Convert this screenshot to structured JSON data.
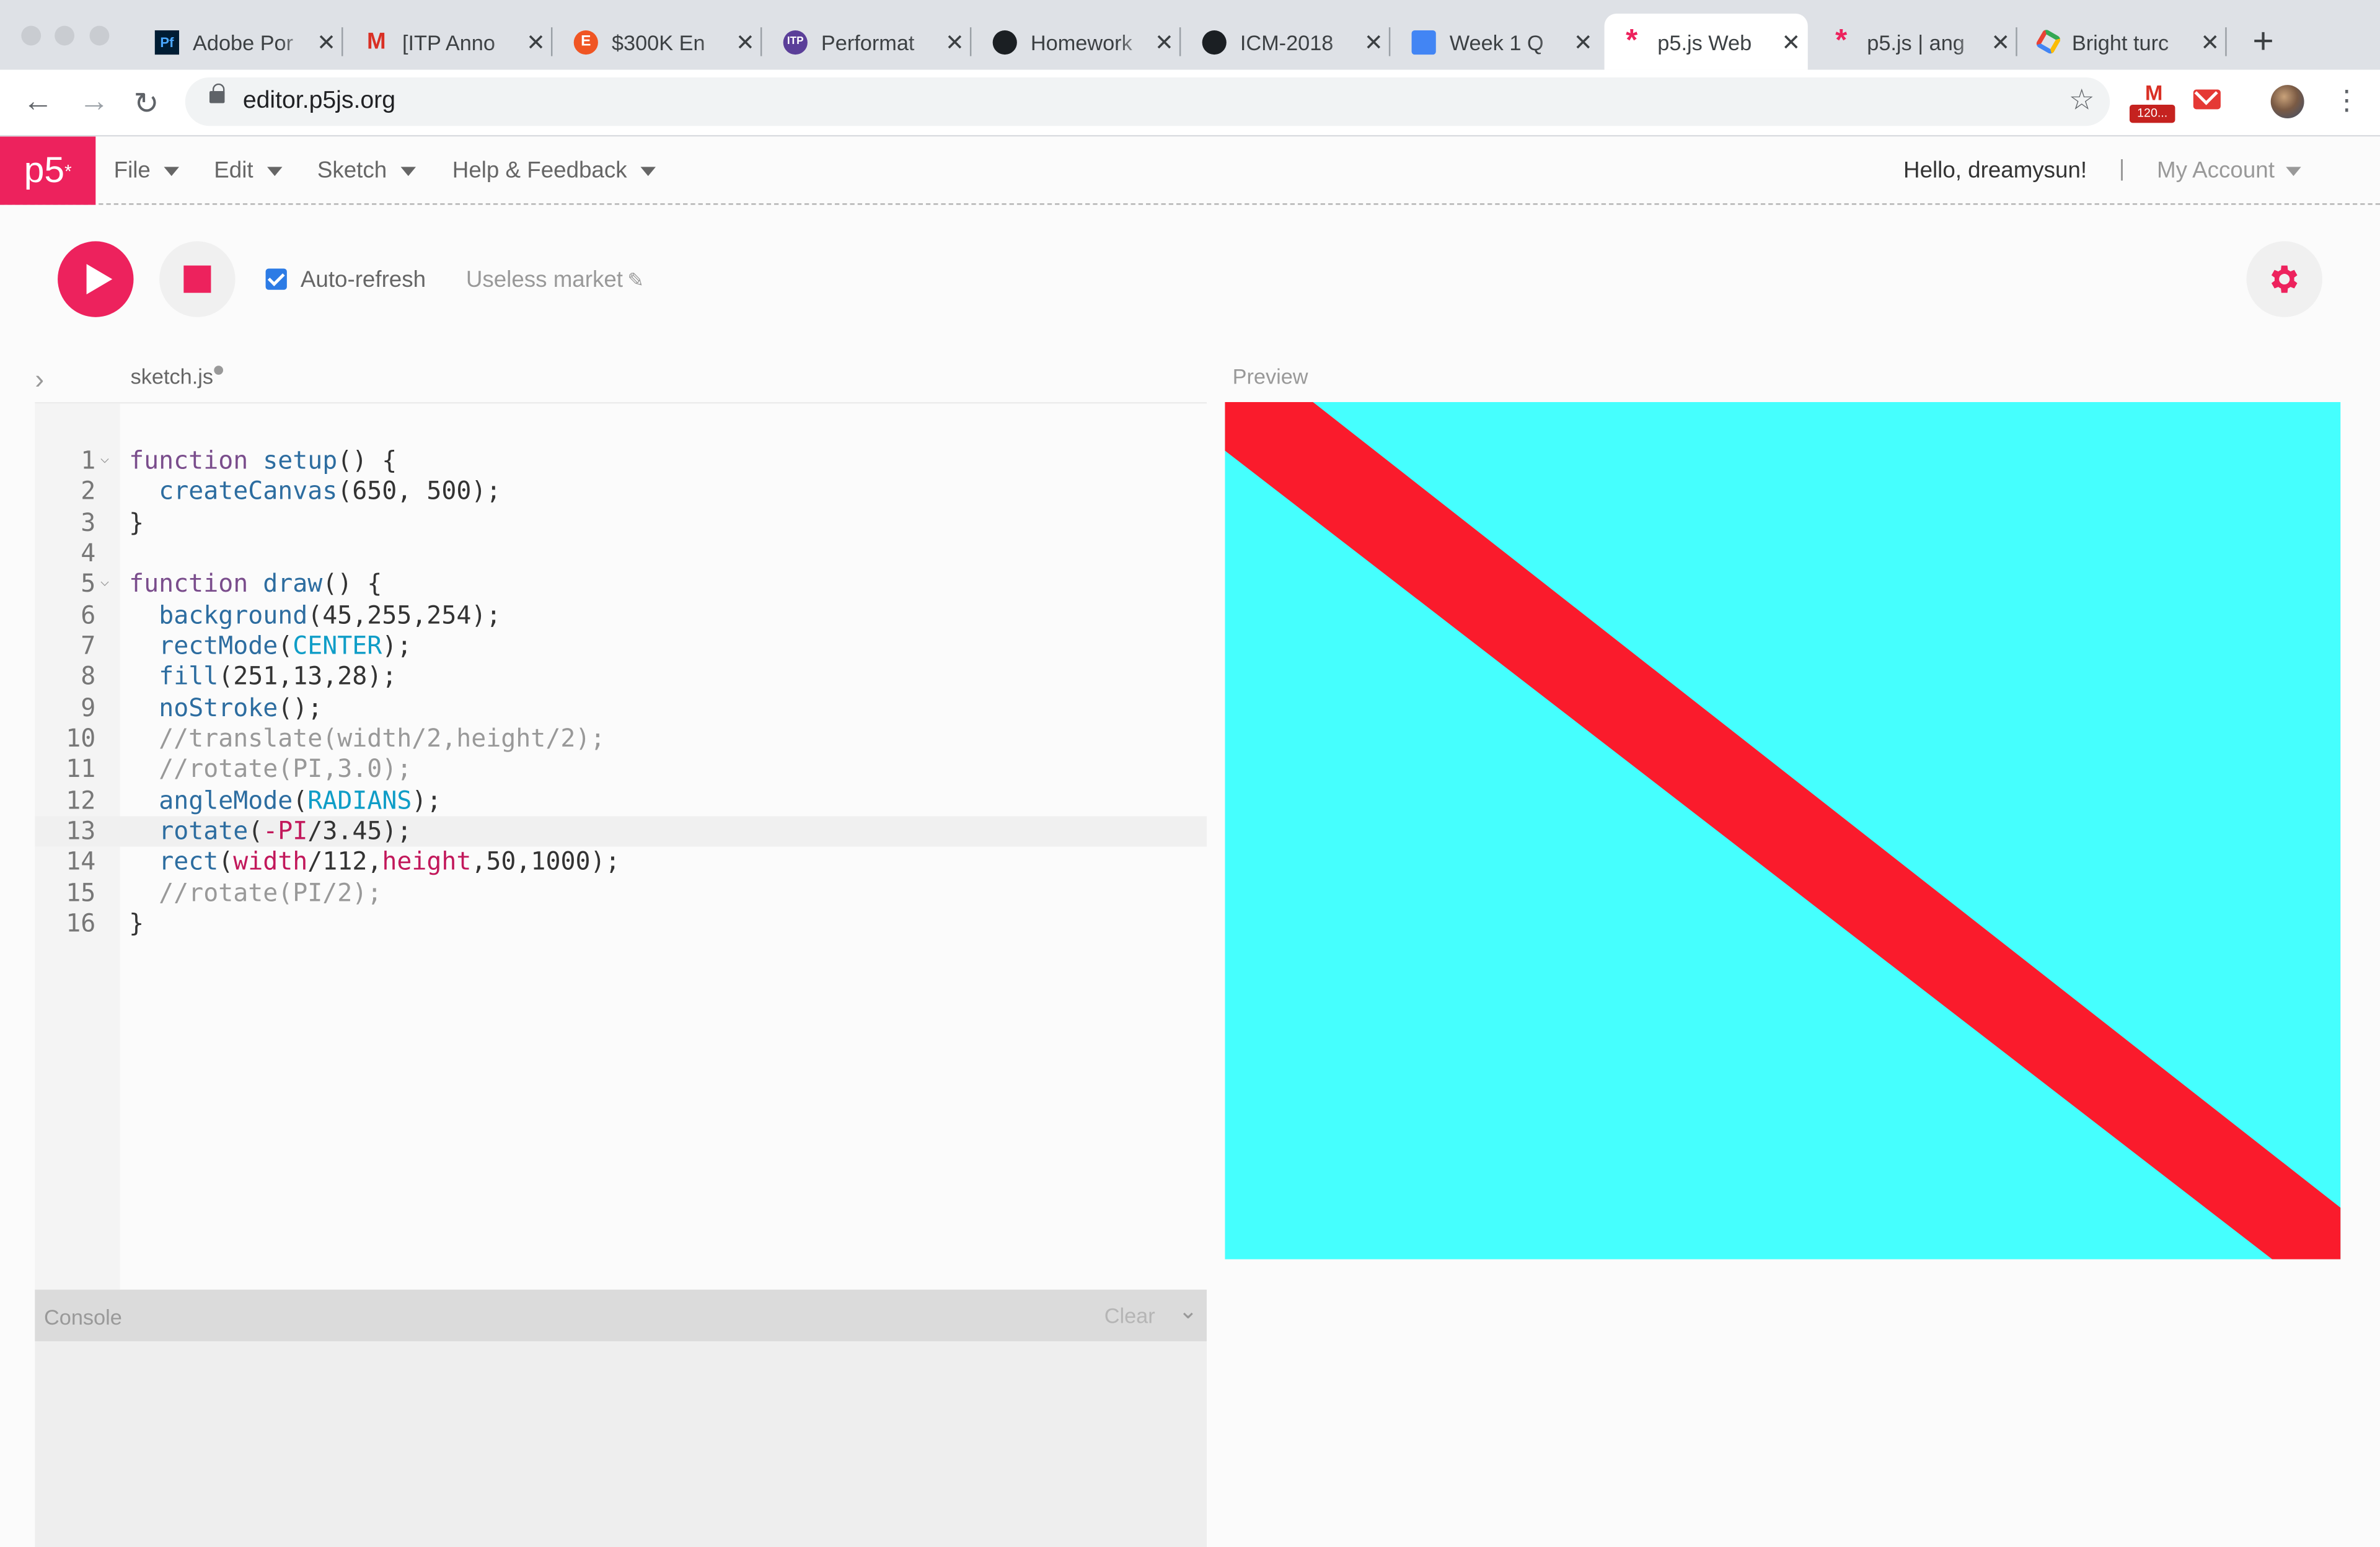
{
  "browser": {
    "tabs": [
      {
        "title": "Adobe Por",
        "icon": "adobe-portfolio-icon"
      },
      {
        "title": "[ITP Anno",
        "icon": "gmail-icon"
      },
      {
        "title": "$300K En",
        "icon": "etsy-icon"
      },
      {
        "title": "Performat",
        "icon": "itp-icon"
      },
      {
        "title": "Homework",
        "icon": "github-icon"
      },
      {
        "title": "ICM-2018",
        "icon": "github-icon"
      },
      {
        "title": "Week 1 Q",
        "icon": "google-docs-icon"
      },
      {
        "title": "p5.js Web",
        "icon": "p5-asterisk-icon",
        "active": true
      },
      {
        "title": "p5.js | ang",
        "icon": "p5-asterisk-icon"
      },
      {
        "title": "Bright turc",
        "icon": "hex-color-icon"
      }
    ],
    "address": "editor.p5js.org",
    "extensions": {
      "mail_badge": "120..."
    }
  },
  "p5": {
    "logo": "p5",
    "menu": [
      "File",
      "Edit",
      "Sketch",
      "Help & Feedback"
    ],
    "greeting": "Hello, dreamysun!",
    "separator": "|",
    "account": "My Account",
    "auto_refresh_label": "Auto-refresh",
    "auto_refresh_checked": true,
    "project_name": "Useless market",
    "file_name": "sketch.js",
    "preview_label": "Preview",
    "console_label": "Console",
    "console_clear": "Clear",
    "code": [
      "function setup() {",
      "  createCanvas(650, 500);",
      "}",
      "",
      "function draw() {",
      "  background(45,255,254);",
      "  rectMode(CENTER);",
      "  fill(251,13,28);",
      "  noStroke();",
      "  //translate(width/2,height/2);",
      "  //rotate(PI,3.0);",
      "  angleMode(RADIANS);",
      "  rotate(-PI/3.45);",
      "  rect(width/112,height,50,1000);",
      "  //rotate(PI/2);",
      "}"
    ],
    "current_line": 13,
    "canvas": {
      "bg": "#45fffe",
      "fill": "#fa1b2c"
    }
  },
  "colors": {
    "accent": "#ed225d",
    "chrome_bg": "#dee1e6"
  }
}
